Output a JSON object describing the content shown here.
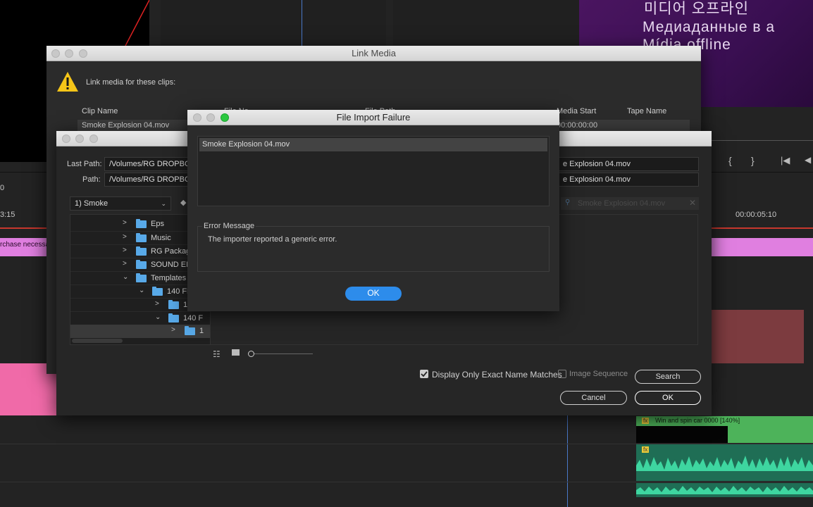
{
  "background": {
    "offline_lines": [
      "미디어 오프라인",
      "Медиаданные в а",
      "Mídia offline"
    ],
    "timecode_left": "3:15",
    "timecode_zero": "0",
    "timecode_right": "00:00:05:10",
    "clip_label_left": "rchase necessar",
    "fx_badge": "fx",
    "fx_badge_2": "fx",
    "clip_win_spin": "Win and spin car 0000 [140%]"
  },
  "link_media": {
    "title": "Link Media",
    "message": "Link media for these clips:",
    "columns": [
      "Clip Name",
      "File Na",
      "File Path",
      "Media Start",
      "Tape Name"
    ],
    "row": {
      "clip_name": "Smoke Explosion 04.mov",
      "media_start": "00:00:00:00"
    }
  },
  "locate": {
    "last_path_label": "Last Path:",
    "last_path_value": "/Volumes/RG DROPBO",
    "path_label": "Path:",
    "path_value": "/Volumes/RG DROPBO",
    "last_file_name": "e Explosion 04.mov",
    "file_name": "e Explosion 04.mov",
    "location_select": "1) Smoke",
    "search_placeholder": "Smoke Explosion 04.mov",
    "tree": [
      {
        "label": "Eps"
      },
      {
        "label": "Music"
      },
      {
        "label": "RG Packag"
      },
      {
        "label": "SOUND EF"
      },
      {
        "label": "Templates"
      },
      {
        "label": "140 Fl"
      },
      {
        "label": "1"
      },
      {
        "label": "140 F"
      },
      {
        "label": "1"
      }
    ],
    "exact_match_label": "Display Only Exact Name Matches",
    "exact_match_checked": true,
    "image_sequence_label": "Image Sequence",
    "image_sequence_checked": false,
    "search_button": "Search",
    "cancel_button": "Cancel",
    "ok_button": "OK"
  },
  "import_failure": {
    "title": "File Import Failure",
    "file_item": "Smoke Explosion 04.mov",
    "error_group_label": "Error Message",
    "error_text": "The importer reported a generic error.",
    "ok_button": "OK"
  },
  "colors": {
    "accent_blue": "#2d8ceb",
    "folder_blue": "#58a9e8",
    "clip_pink": "#e07fe0",
    "clip_green": "#4db35a",
    "warning_yellow": "#f5c518"
  }
}
